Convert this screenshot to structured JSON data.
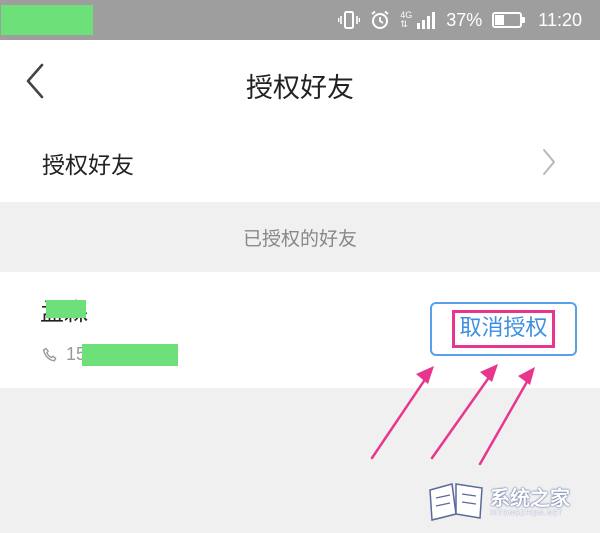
{
  "status_bar": {
    "network": "4G",
    "battery_percent": "37%",
    "battery_level": 0.37,
    "time": "11:20"
  },
  "navbar": {
    "title": "授权好友"
  },
  "auth_row": {
    "label": "授权好友"
  },
  "section": {
    "header": "已授权的好友"
  },
  "friend": {
    "name": "孟森",
    "phone": "15        20"
  },
  "revoke_button": {
    "label": "取消授权"
  },
  "watermark": {
    "text": "系统之家",
    "subtext": "XITONGZHIJIA.NET"
  },
  "colors": {
    "status_bar_bg": "#9e9e9e",
    "redaction": "#6ee07a",
    "button_border": "#5aa0e8",
    "highlight": "#e8368f",
    "arrow": "#e8368f"
  }
}
